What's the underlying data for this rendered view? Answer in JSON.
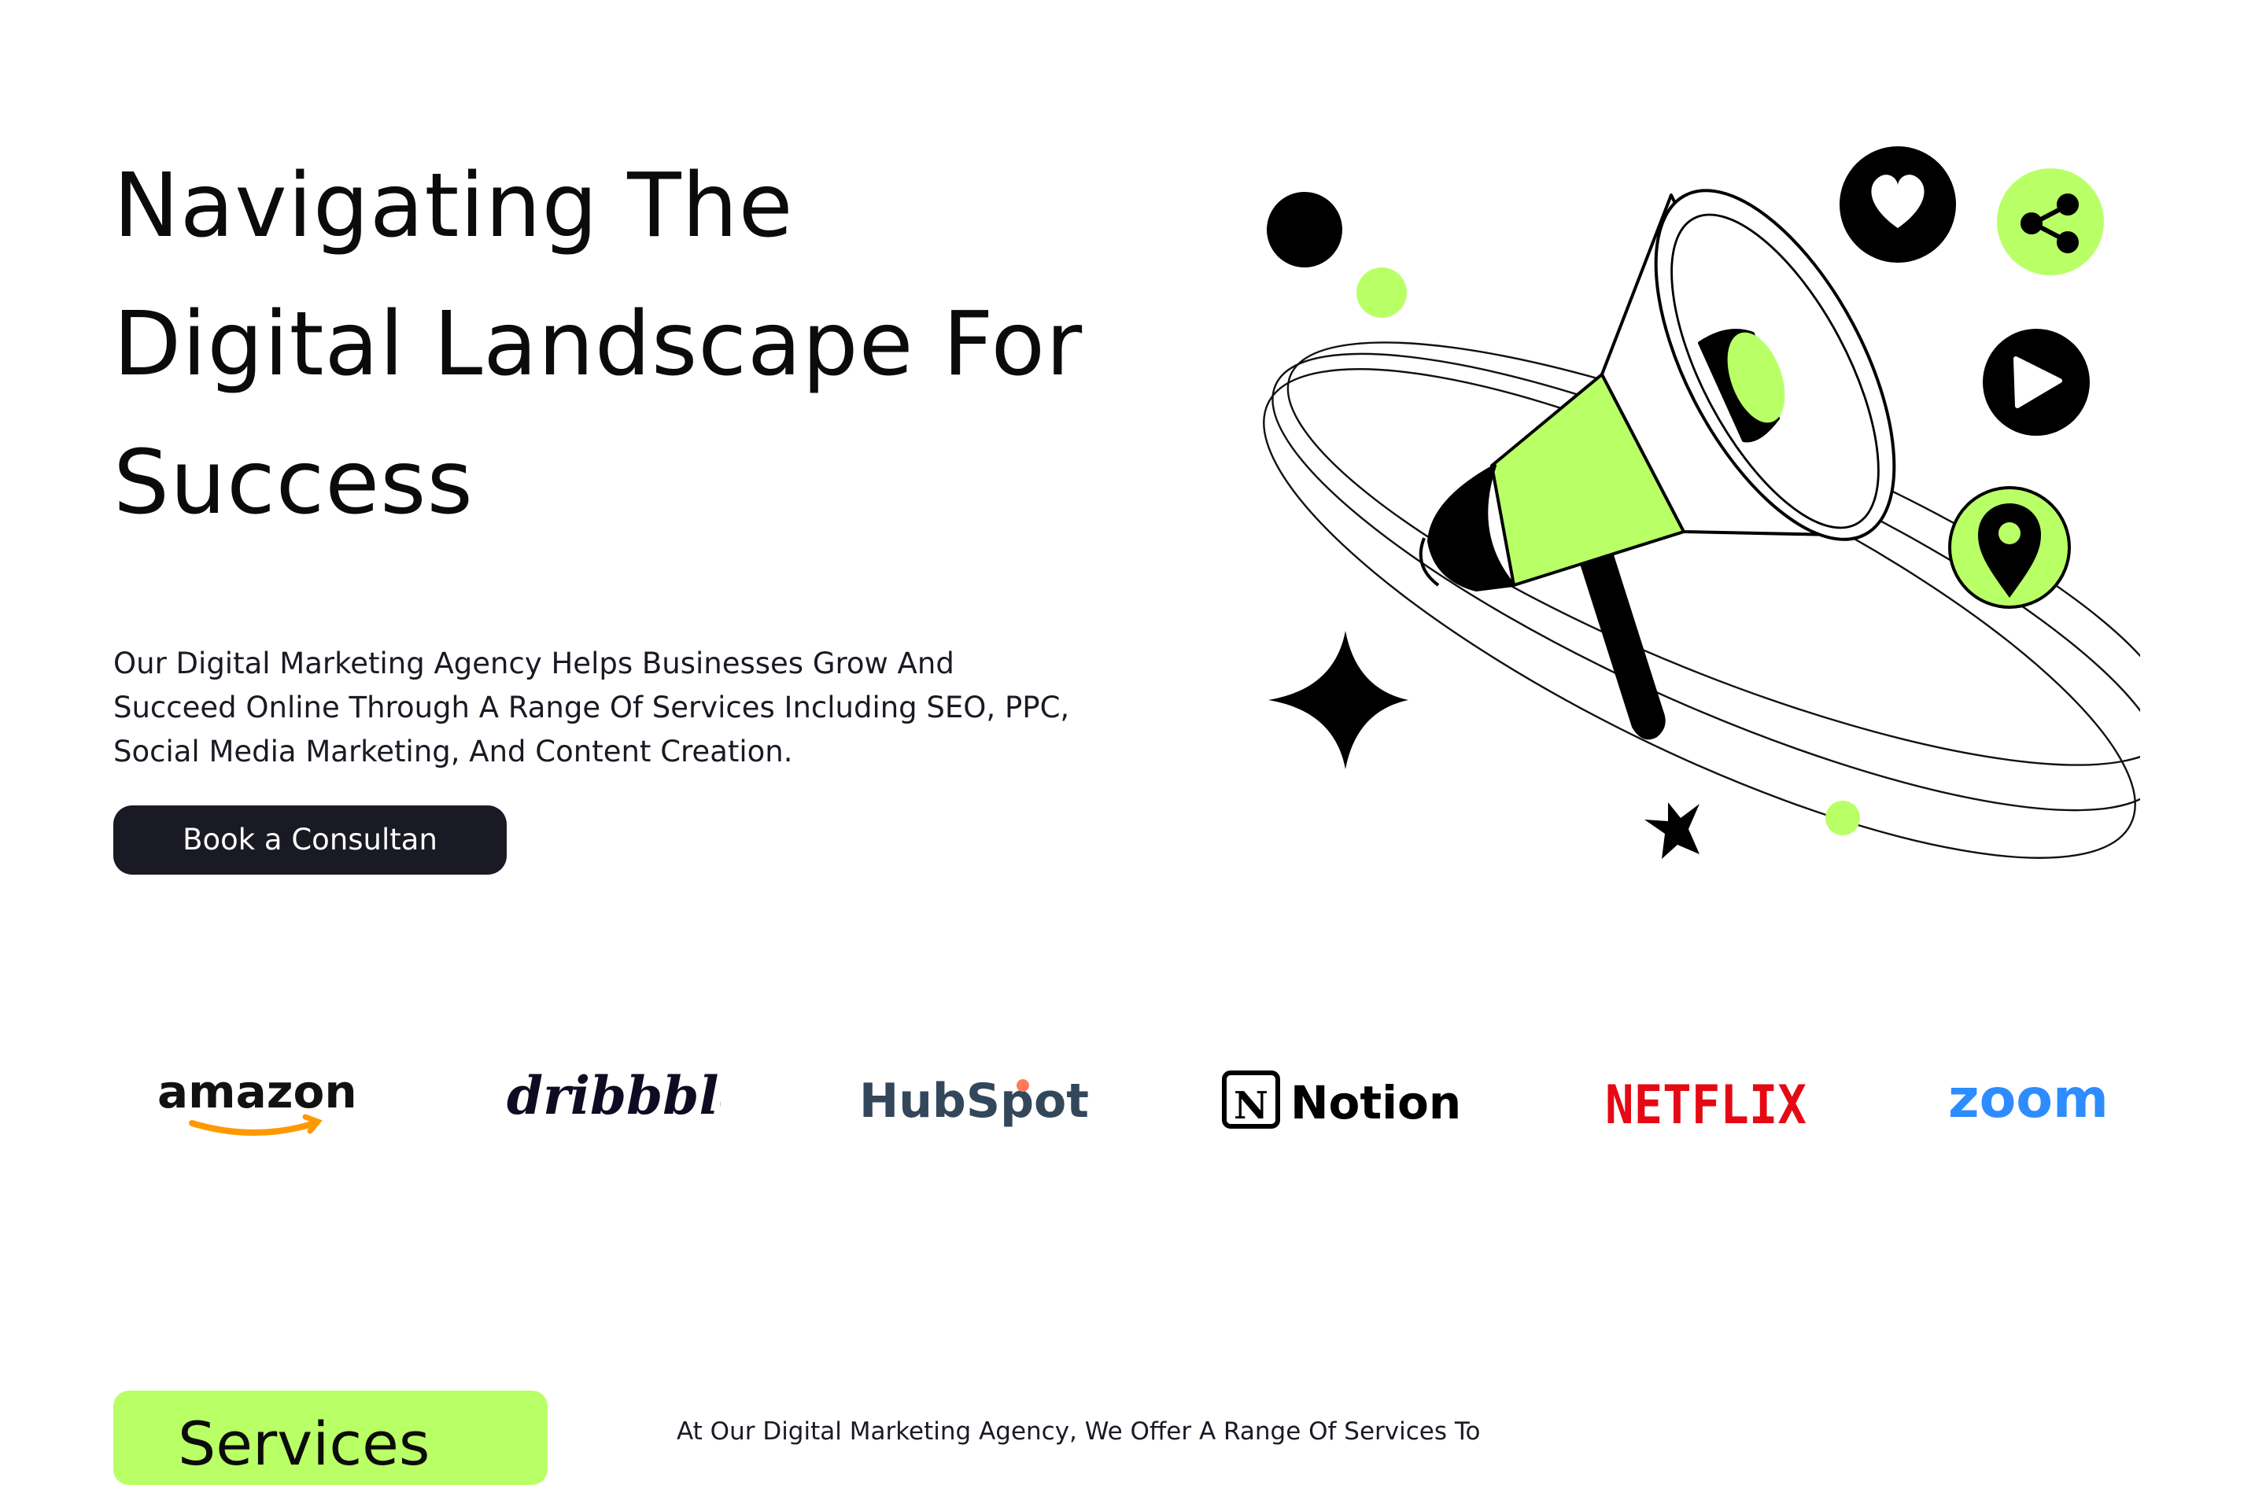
{
  "hero": {
    "title_lines": [
      "Navigating The",
      "Digital Landscape For",
      "Success"
    ],
    "description_lines": [
      "Our Digital Marketing Agency Helps Businesses Grow And",
      "Succeed Online Through A Range Of Services Including SEO, PPC,",
      "Social Media Marketing, And Content Creation."
    ],
    "cta_label": "Book a Consultan"
  },
  "illustration": {
    "icons": [
      "megaphone-icon",
      "heart-icon",
      "share-icon",
      "play-icon",
      "location-pin-icon",
      "sparkle-star-icon"
    ],
    "accent_color": "#b9ff66",
    "dark_color": "#000000"
  },
  "logos": {
    "amazon": "amazon",
    "dribbble": "dribbble",
    "hubspot": "HubSpot",
    "notion": "Notion",
    "notion_mark": "N",
    "netflix": "NETFLIX",
    "zoom": "zoom"
  },
  "services": {
    "tag_label": "Services",
    "description": "At Our Digital Marketing Agency, We Offer A Range Of Services To"
  },
  "colors": {
    "accent": "#b9ff66",
    "dark": "#191a23",
    "amazon_orange": "#ff9900",
    "hubspot_navy": "#33475b",
    "hubspot_orange": "#ff7a59",
    "netflix_red": "#e50914",
    "zoom_blue": "#2d8cff",
    "dribbble_navy": "#0d0c22"
  }
}
